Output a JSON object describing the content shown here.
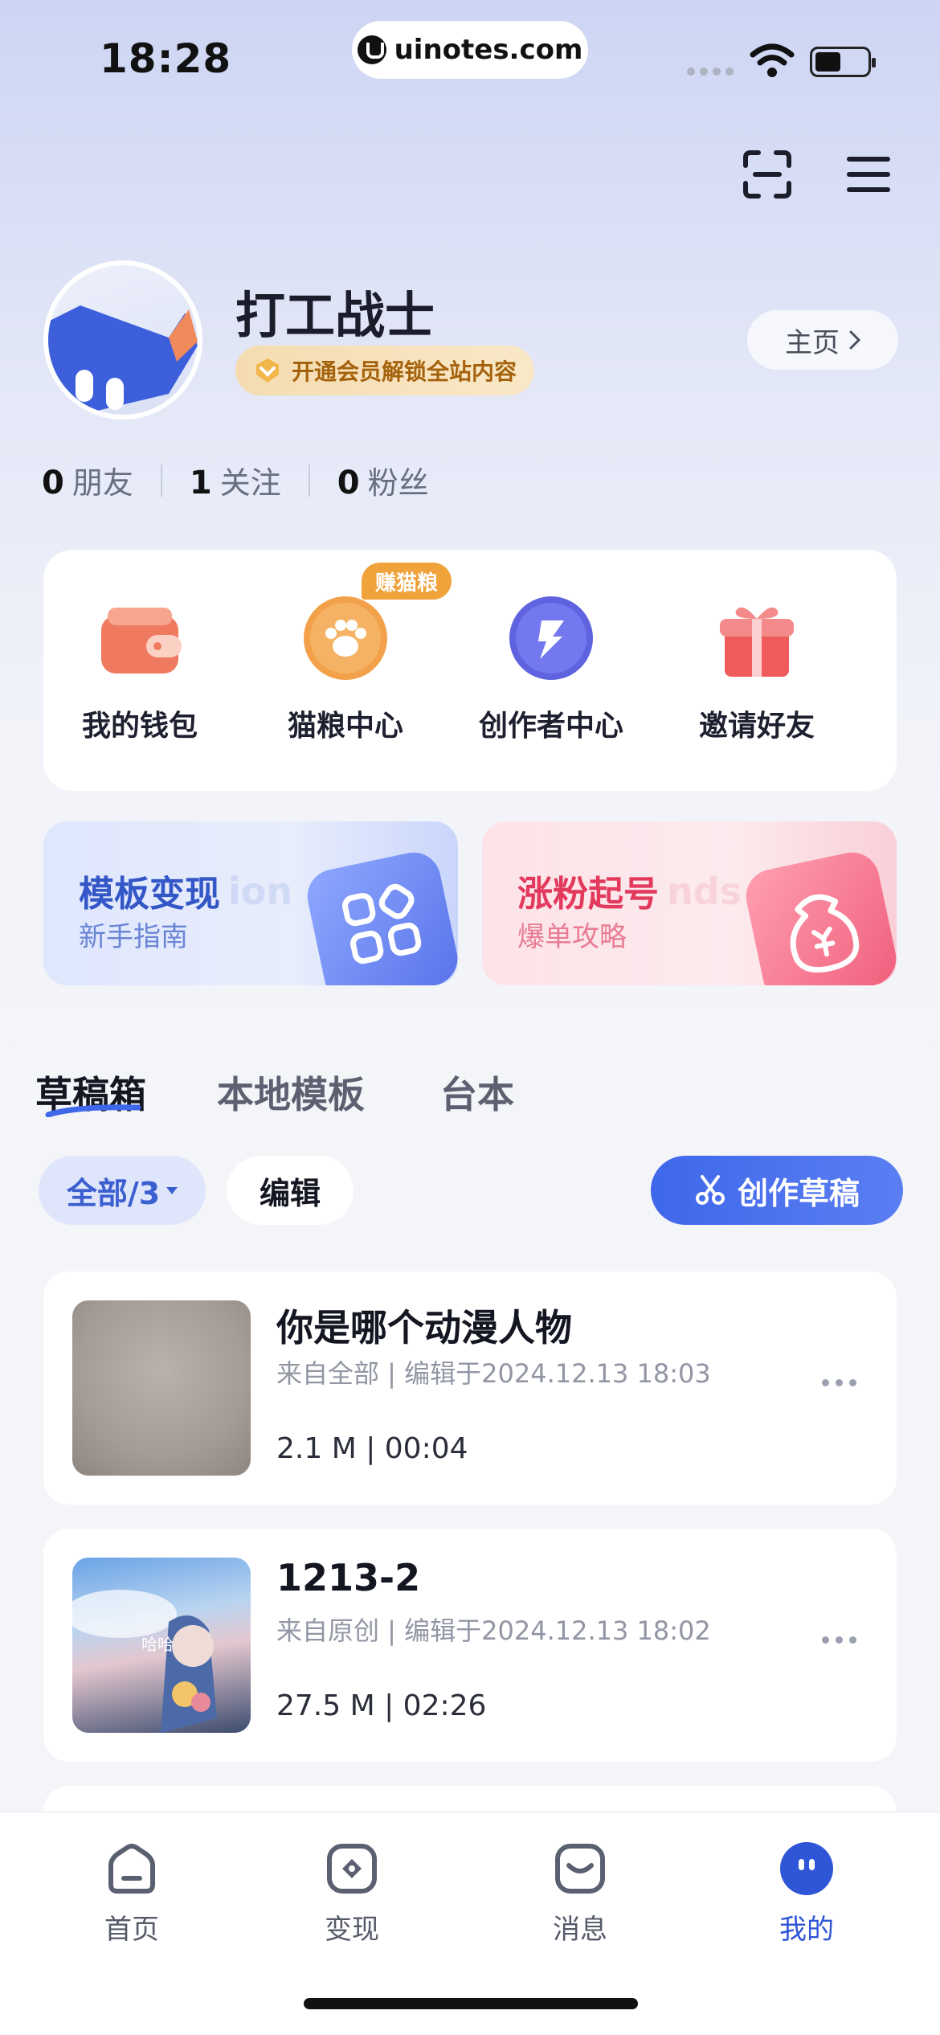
{
  "status_bar": {
    "time": "18:28",
    "url": "uinotes.com"
  },
  "profile": {
    "username": "打工战士",
    "vip_text": "开通会员解锁全站内容",
    "homepage_label": "主页",
    "stats": [
      {
        "count": "0",
        "label": "朋友"
      },
      {
        "count": "1",
        "label": "关注"
      },
      {
        "count": "0",
        "label": "粉丝"
      }
    ]
  },
  "quick_entries": {
    "earn_tag": "赚猫粮",
    "items": [
      {
        "label": "我的钱包",
        "icon": "wallet-icon"
      },
      {
        "label": "猫粮中心",
        "icon": "paw-icon"
      },
      {
        "label": "创作者中心",
        "icon": "creator-icon"
      },
      {
        "label": "邀请好友",
        "icon": "gift-icon"
      }
    ]
  },
  "banners": [
    {
      "title": "模板变现",
      "subtitle": "新手指南",
      "ghost": "ion"
    },
    {
      "title": "涨粉起号",
      "subtitle": "爆单攻略",
      "ghost": "nds"
    }
  ],
  "tabs": [
    "草稿箱",
    "本地模板",
    "台本"
  ],
  "filters": {
    "all_label": "全部/3",
    "edit_label": "编辑",
    "create_label": "创作草稿"
  },
  "drafts": [
    {
      "title": "你是哪个动漫人物",
      "meta": "来自全部 | 编辑于2024.12.13 18:03",
      "size": "2.1 M | 00:04"
    },
    {
      "title": "1213-2",
      "meta": "来自原创 | 编辑于2024.12.13 18:02",
      "size": "27.5 M | 02:26",
      "thumb_text": "哈哈"
    }
  ],
  "bottom_nav": [
    {
      "label": "首页",
      "icon": "home-icon"
    },
    {
      "label": "变现",
      "icon": "monetize-icon"
    },
    {
      "label": "消息",
      "icon": "message-icon"
    },
    {
      "label": "我的",
      "icon": "me-icon",
      "active": true
    }
  ],
  "colors": {
    "accent": "#3f67ea",
    "vip": "#a5620c",
    "pink": "#e2395c"
  }
}
